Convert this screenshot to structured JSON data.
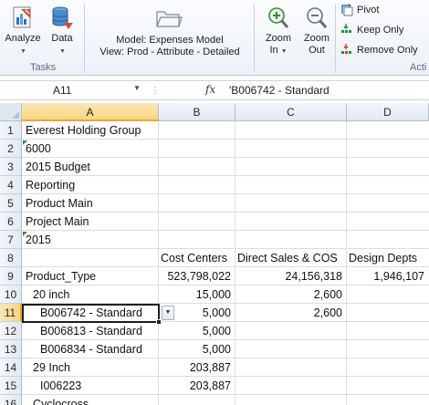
{
  "ribbon": {
    "analyze_label": "Analyze",
    "data_label": "Data",
    "tasks_group_label": "Tasks",
    "model_line": "Model: Expenses Model",
    "view_line": "View: Prod - Attribute - Detailed",
    "zoom_in_line1": "Zoom",
    "zoom_in_line2": "In",
    "zoom_out_line1": "Zoom",
    "zoom_out_line2": "Out",
    "pivot_label": "Pivot",
    "keep_only_label": "Keep Only",
    "remove_only_label": "Remove Only",
    "actions_group_label": "Acti",
    "accent_color": "#2e6fb7"
  },
  "formula_bar": {
    "name_box": "A11",
    "fx_label": "fx",
    "formula": "'B006742 - Standard"
  },
  "grid": {
    "columns": [
      "A",
      "B",
      "C",
      "D"
    ],
    "selected_column": "A",
    "selected_row": "11",
    "selection_color": "#f8d581",
    "rows": [
      {
        "num": "1",
        "a": "Everest Holding Group",
        "b": "",
        "c": "",
        "d": ""
      },
      {
        "num": "2",
        "a": "6000",
        "b": "",
        "c": "",
        "d": ""
      },
      {
        "num": "3",
        "a": "2015 Budget",
        "b": "",
        "c": "",
        "d": ""
      },
      {
        "num": "4",
        "a": "Reporting",
        "b": "",
        "c": "",
        "d": ""
      },
      {
        "num": "5",
        "a": "Product Main",
        "b": "",
        "c": "",
        "d": ""
      },
      {
        "num": "6",
        "a": "Project Main",
        "b": "",
        "c": "",
        "d": ""
      },
      {
        "num": "7",
        "a": "2015",
        "b": "",
        "c": "",
        "d": ""
      },
      {
        "num": "8",
        "a": "",
        "b": "Cost Centers",
        "c": "Direct Sales & COS",
        "d": "Design Depts"
      },
      {
        "num": "9",
        "a": "Product_Type",
        "b": "523,798,022",
        "c": "24,156,318",
        "d": "1,946,107"
      },
      {
        "num": "10",
        "a": "20 inch",
        "b": "15,000",
        "c": "2,600",
        "d": ""
      },
      {
        "num": "11",
        "a": "B006742 - Standard",
        "b": "5,000",
        "c": "2,600",
        "d": ""
      },
      {
        "num": "12",
        "a": "B006813 - Standard",
        "b": "5,000",
        "c": "",
        "d": ""
      },
      {
        "num": "13",
        "a": "B006834 - Standard",
        "b": "5,000",
        "c": "",
        "d": ""
      },
      {
        "num": "14",
        "a": "29 Inch",
        "b": "203,887",
        "c": "",
        "d": ""
      },
      {
        "num": "15",
        "a": "I006223",
        "b": "203,887",
        "c": "",
        "d": ""
      },
      {
        "num": "16",
        "a": "Cyclocross",
        "b": "",
        "c": "",
        "d": ""
      }
    ]
  }
}
